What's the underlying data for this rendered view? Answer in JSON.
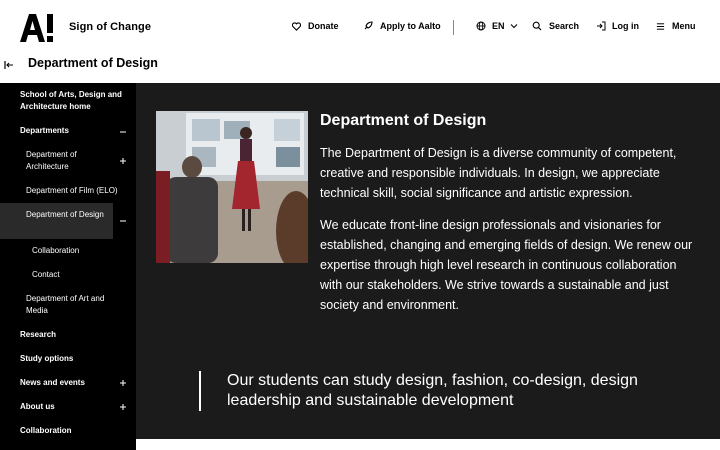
{
  "header": {
    "logo_text": "A!",
    "tagline": "Sign of Change",
    "nav": {
      "donate": "Donate",
      "apply": "Apply to Aalto",
      "lang": "EN",
      "search": "Search",
      "login": "Log in",
      "menu": "Menu"
    }
  },
  "subheader": {
    "title": "Department of Design"
  },
  "sidebar": {
    "items": [
      {
        "label": "School of Arts, Design and Architecture home"
      },
      {
        "label": "Departments",
        "toggle": "−"
      },
      {
        "label": "Department of Architecture",
        "toggle": "+"
      },
      {
        "label": "Department of Film (ELO)"
      },
      {
        "label": "Department of Design",
        "toggle": "−"
      },
      {
        "label": "Collaboration"
      },
      {
        "label": "Contact"
      },
      {
        "label": "Department of Art and Media"
      },
      {
        "label": "Research"
      },
      {
        "label": "Study options"
      },
      {
        "label": "News and events",
        "toggle": "+"
      },
      {
        "label": "About us",
        "toggle": "+"
      },
      {
        "label": "Collaboration"
      }
    ]
  },
  "main": {
    "heading": "Department of Design",
    "para1": "The Department of Design is a diverse community of competent, creative and responsible individuals. In design, we appreciate technical skill, social significance and artistic expression.",
    "para2": "We educate front-line design professionals and visionaries for established, changing and emerging fields of design. We renew our expertise through high level research in continuous collaboration with our stakeholders. We strive towards a sustainable and just society and environment.",
    "quote": "Our students can study design, fashion, co-design, design leadership and sustainable development"
  },
  "colors": {
    "sidebar_bg": "#000000",
    "main_bg": "#1b1b1b",
    "selected_bg": "#2a2a2a"
  }
}
